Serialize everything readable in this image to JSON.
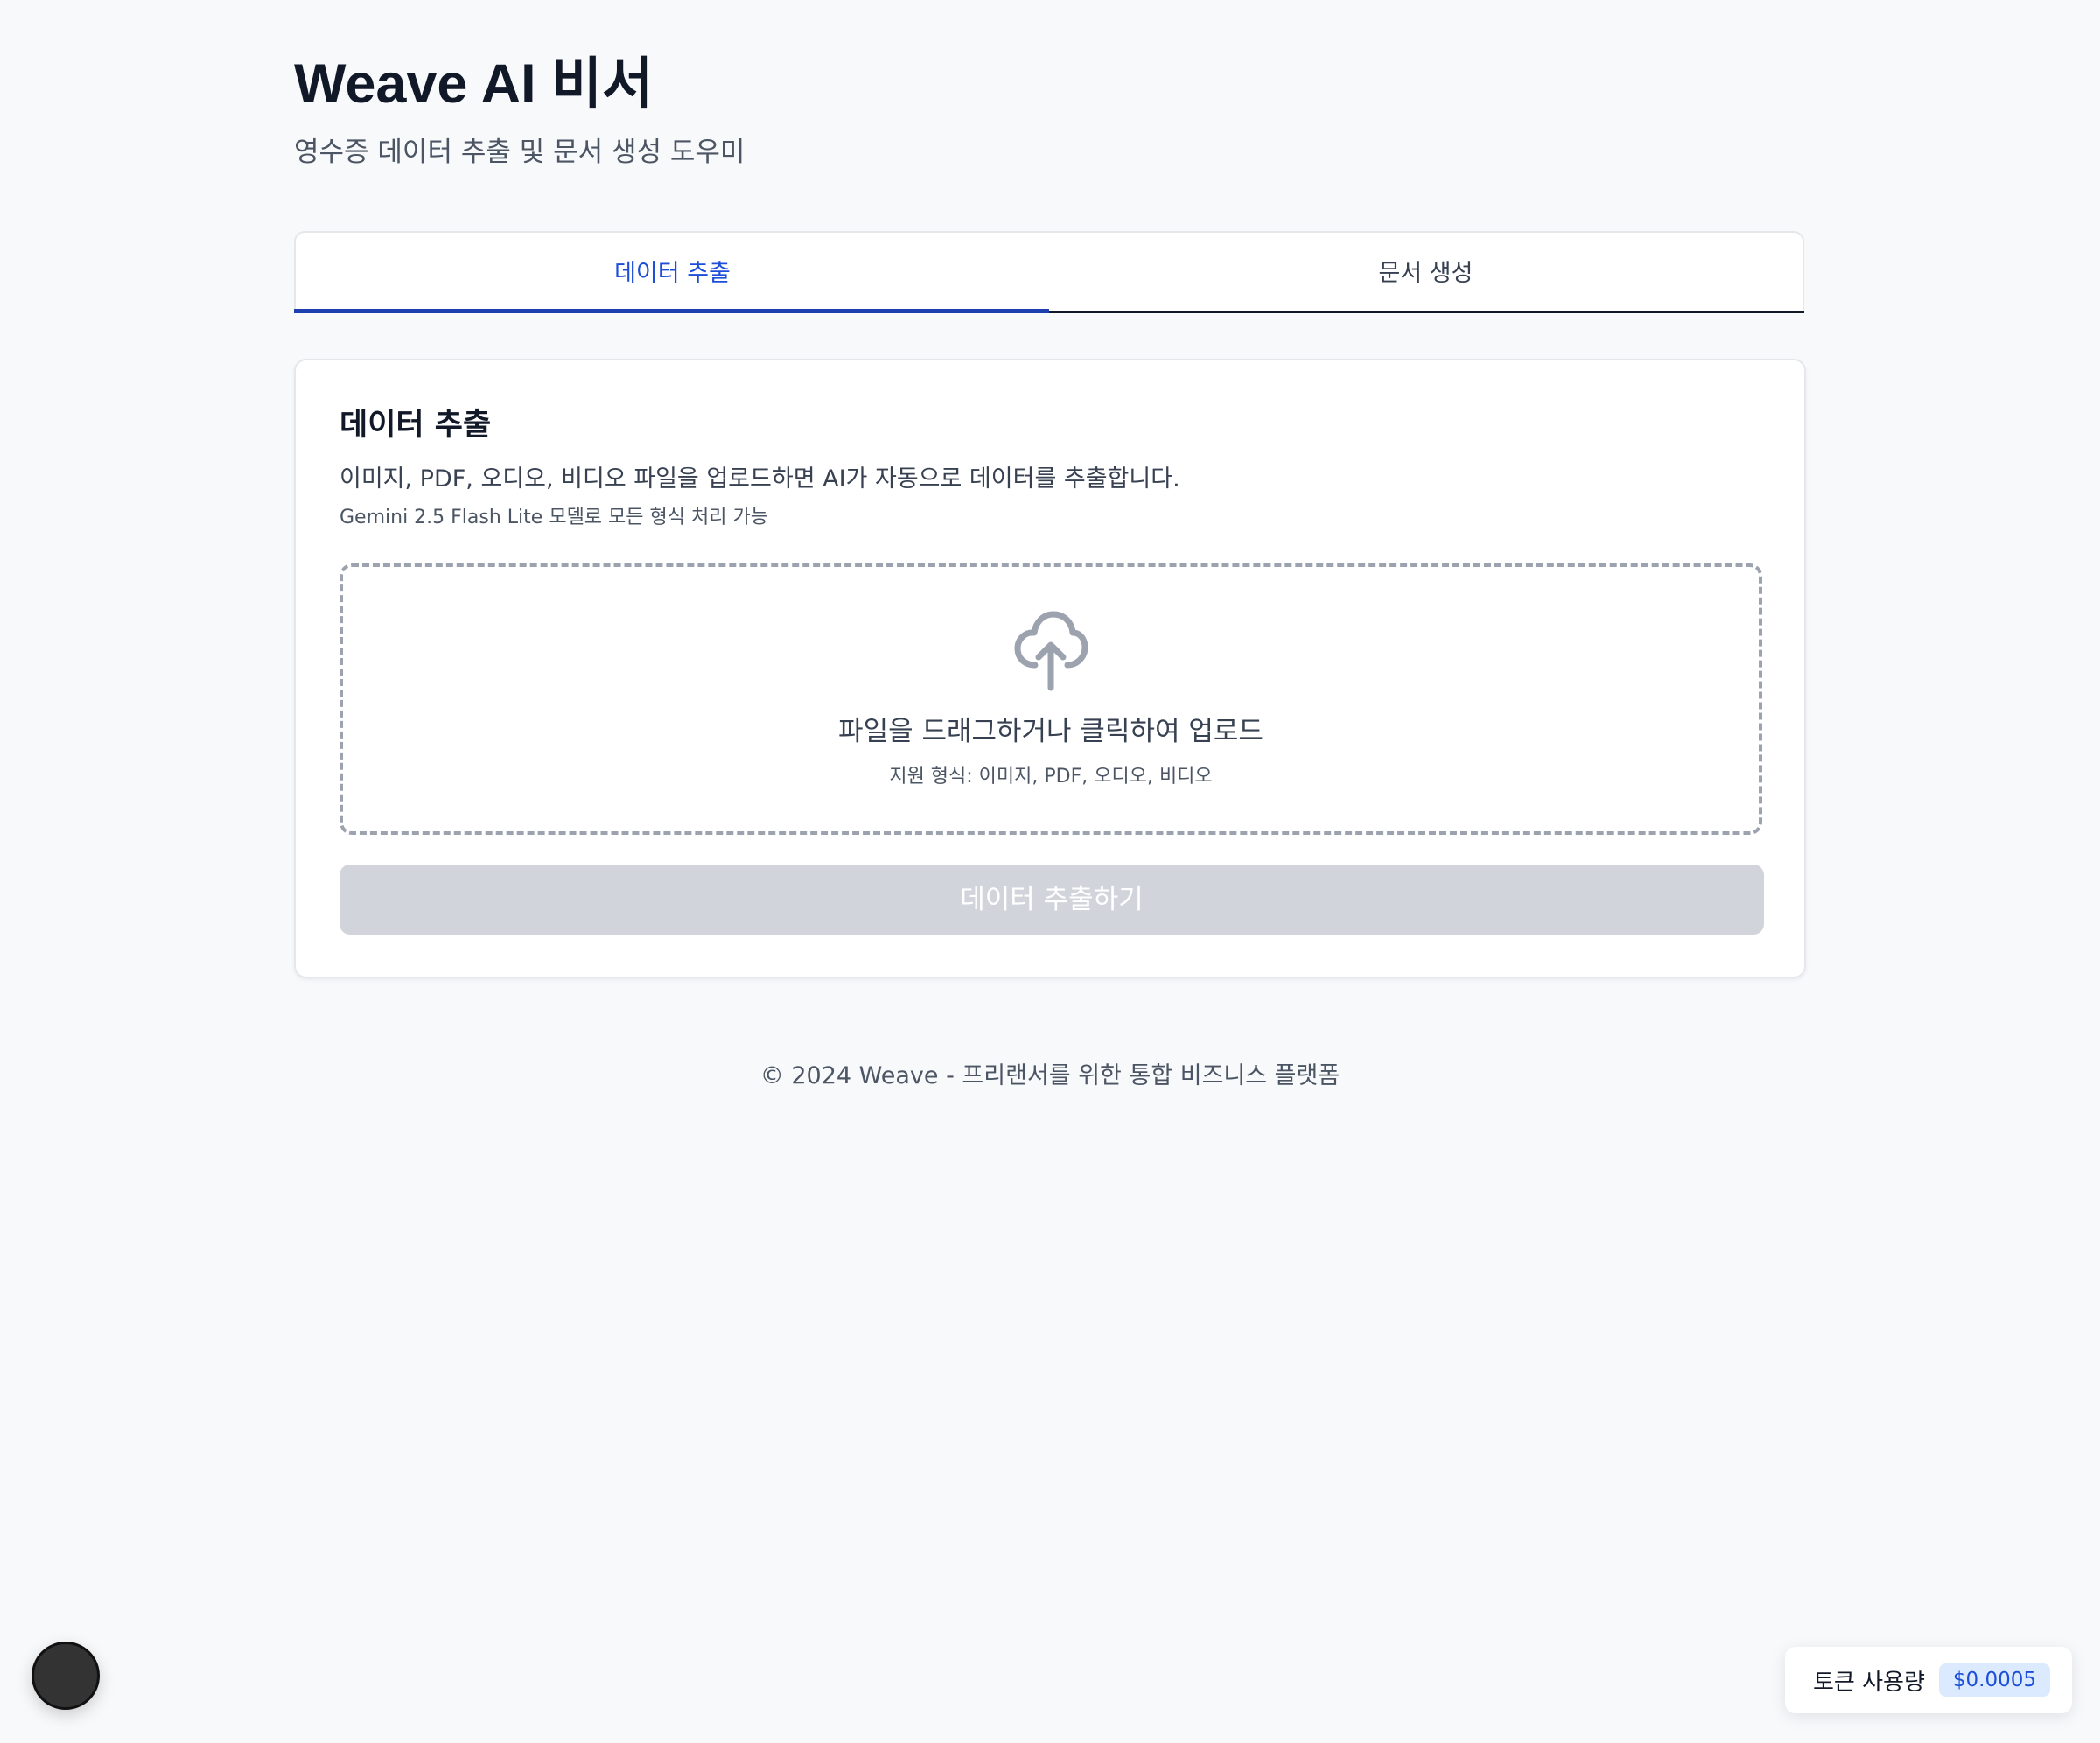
{
  "header": {
    "title": "Weave AI 비서",
    "subtitle": "영수증 데이터 추출 및 문서 생성 도우미"
  },
  "tabs": [
    {
      "label": "데이터 추출",
      "active": true
    },
    {
      "label": "문서 생성",
      "active": false
    }
  ],
  "card": {
    "title": "데이터 추출",
    "description": "이미지, PDF, 오디오, 비디오 파일을 업로드하면 AI가 자동으로 데이터를 추출합니다.",
    "note": "Gemini 2.5 Flash Lite 모델로 모든 형식 처리 가능",
    "dropzone": {
      "icon": "cloud-upload-icon",
      "title": "파일을 드래그하거나 클릭하여 업로드",
      "subtitle": "지원 형식: 이미지, PDF, 오디오, 비디오"
    },
    "button_label": "데이터 추출하기"
  },
  "footer": {
    "text": "© 2024 Weave - 프리랜서를 위한 통합 비즈니스 플랫폼"
  },
  "token_usage": {
    "label": "토큰 사용량",
    "value": "$0.0005"
  },
  "colors": {
    "accent": "#1d4ed8",
    "tab_underline": "#1e40af",
    "page_background": "#f8f9fb",
    "disabled_button": "#d1d5db",
    "badge_background": "#dbeafe"
  }
}
